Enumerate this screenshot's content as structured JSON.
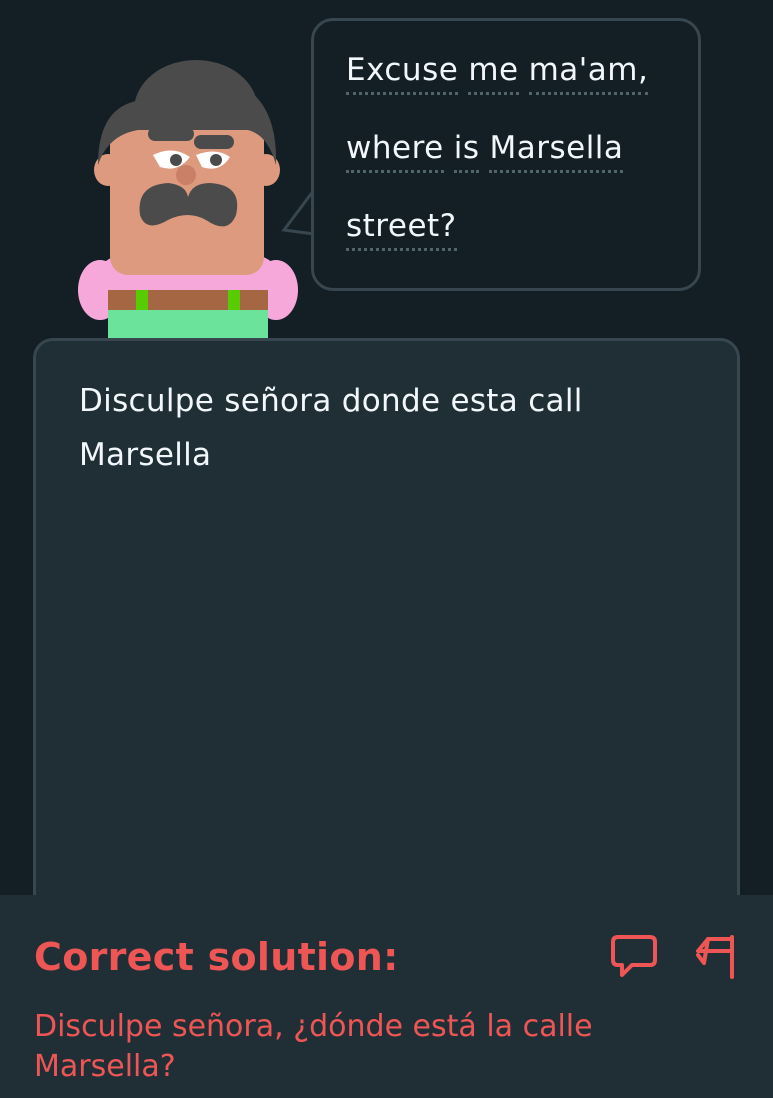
{
  "prompt": {
    "lines": [
      [
        "Excuse",
        "me",
        "ma'am,"
      ],
      [
        "where",
        "is",
        "Marsella"
      ],
      [
        "street?"
      ]
    ]
  },
  "answer": {
    "text": "Disculpe señora donde esta call Marsella"
  },
  "feedback": {
    "title": "Correct solution:",
    "solution": "Disculpe señora, ¿dónde está la calle Marsella?",
    "color": "#ee5555"
  },
  "icons": {
    "discuss": "comment-icon",
    "report": "flag-icon"
  }
}
